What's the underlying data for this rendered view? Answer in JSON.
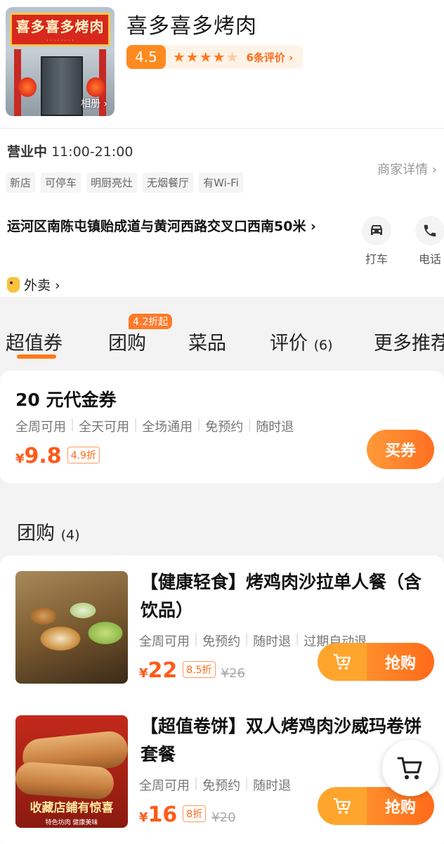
{
  "shop": {
    "photo_sign": "喜多喜多烤肉",
    "album_label": "相册 ›",
    "name": "喜多喜多烤肉",
    "rating": "4.5",
    "rating_stars": 4.5,
    "review_link": "6条评价 ›"
  },
  "info": {
    "status": "营业中",
    "hours": "11:00-21:00",
    "tags": [
      "新店",
      "可停车",
      "明厨亮灶",
      "无烟餐厅",
      "有Wi-Fi"
    ],
    "merchant_detail": "商家详情 ›",
    "address": "运河区南陈屯镇贻成道与黄河西路交叉口西南50米 ›",
    "takeout": "外卖 ›",
    "taxi_label": "打车",
    "phone_label": "电话"
  },
  "tabs": {
    "items": [
      {
        "label": "超值券",
        "count": ""
      },
      {
        "label": "团购",
        "count": ""
      },
      {
        "label": "菜品",
        "count": ""
      },
      {
        "label": "评价",
        "count": "(6)"
      },
      {
        "label": "更多推荐",
        "count": ""
      }
    ],
    "badge": "4.2折起"
  },
  "voucher": {
    "title": "20 元代金券",
    "attrs": [
      "全周可用",
      "全天可用",
      "全场通用",
      "免预约",
      "随时退"
    ],
    "currency": "¥",
    "price": "9.8",
    "discount": "4.9折",
    "buy_label": "买券"
  },
  "group": {
    "heading": "团购",
    "count": "(4)",
    "deals": [
      {
        "title": "【健康轻食】烤鸡肉沙拉单人餐（含饮品）",
        "attrs": [
          "全周可用",
          "免预约",
          "随时退",
          "过期自动退"
        ],
        "currency": "¥",
        "price": "22",
        "discount": "8.5折",
        "original": "¥26",
        "buy_label": "抢购"
      },
      {
        "title": "【超值卷饼】双人烤鸡肉沙威玛卷饼套餐",
        "attrs": [
          "全周可用",
          "免预约",
          "随时退"
        ],
        "currency": "¥",
        "price": "16",
        "discount": "8折",
        "original": "¥20",
        "buy_label": "抢购",
        "image_banner": "收藏店鋪有惊喜",
        "image_sub": "特色坊肉  健康美味"
      }
    ]
  },
  "colors": {
    "accent": "#ff7a1a",
    "price": "#ff5a1a",
    "rating_bg": "#ff8a1f"
  }
}
